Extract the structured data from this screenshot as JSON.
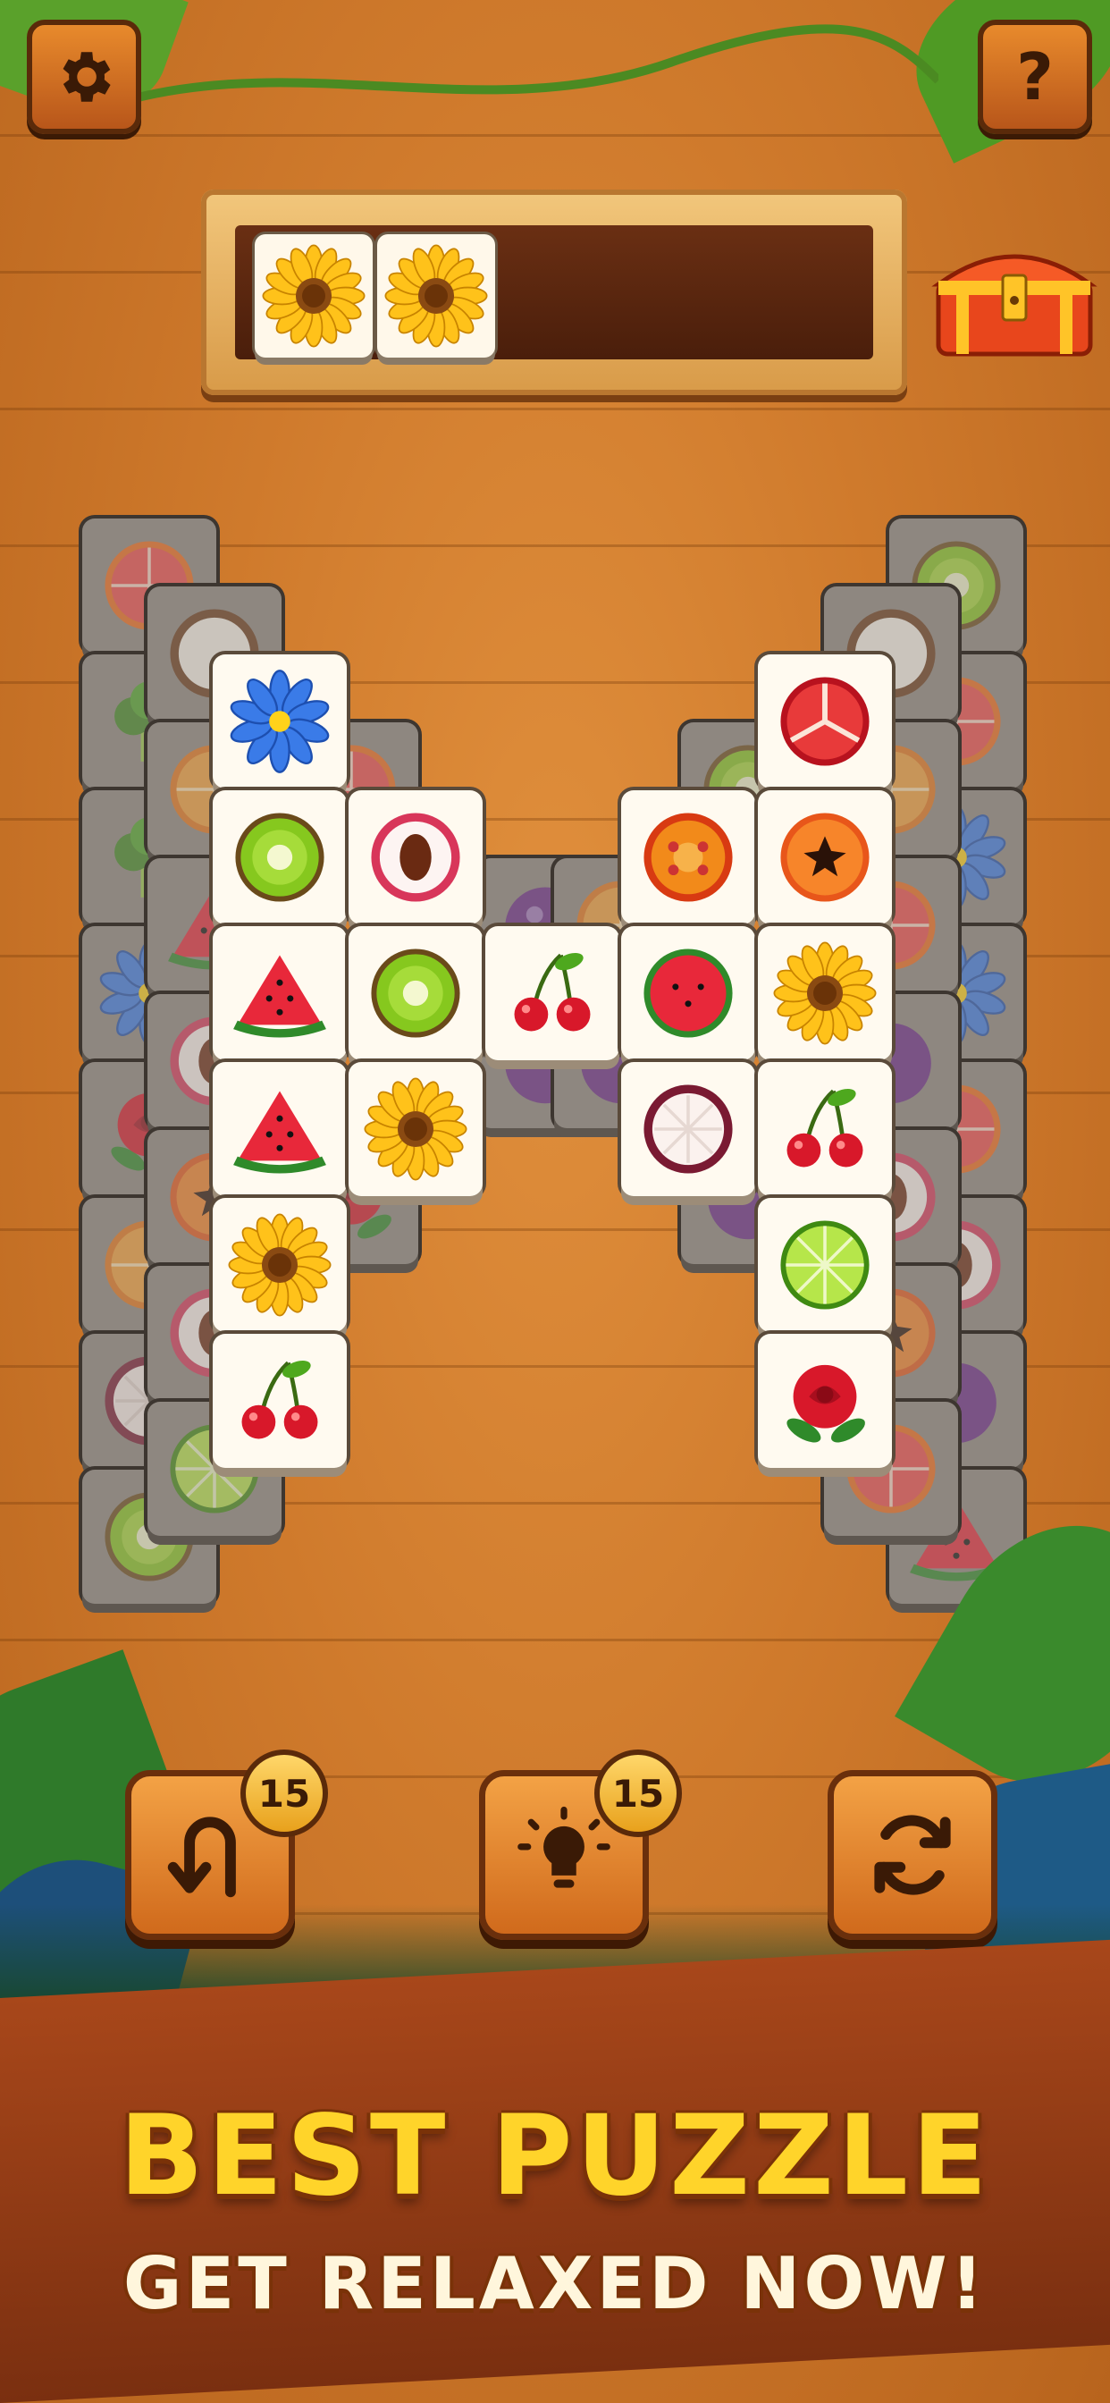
{
  "header": {
    "settings_icon": "gear-icon",
    "help_label": "?"
  },
  "tray": {
    "slots_total": 7,
    "tiles": [
      "sunflower",
      "sunflower"
    ]
  },
  "reward": {
    "icon": "treasure-chest-icon"
  },
  "board": {
    "free_tiles": [
      "flower-blue",
      "pomegranate",
      "kiwi",
      "lychee",
      "tomato",
      "papaya",
      "watermelon",
      "kiwi",
      "cherry",
      "watermelon-round",
      "sunflower",
      "watermelon",
      "sunflower",
      "mangosteen",
      "cherry",
      "sunflower",
      "lime",
      "cherry",
      "rose"
    ]
  },
  "controls": {
    "undo": {
      "icon": "undo-arrow-icon",
      "count": "15"
    },
    "hint": {
      "icon": "lightbulb-icon",
      "count": "15"
    },
    "shuffle": {
      "icon": "shuffle-icon"
    }
  },
  "promo": {
    "headline": "BEST PUZZLE",
    "subline": "GET RELAXED NOW!"
  },
  "colors": {
    "background": "#cf7a2c",
    "tile": "#fffaf0",
    "headline": "#ffd42a",
    "banner": "#8c3a15"
  }
}
